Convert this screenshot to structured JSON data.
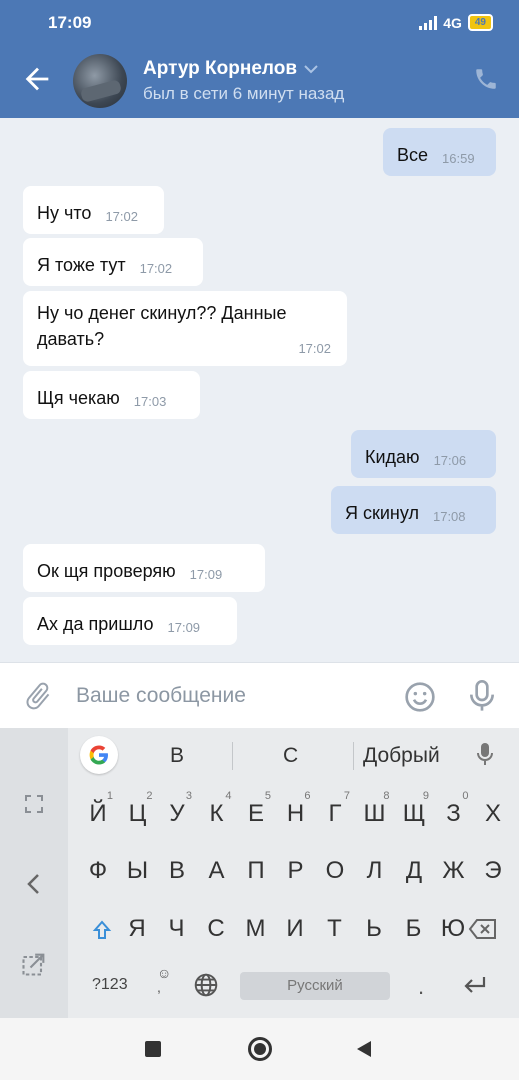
{
  "status": {
    "time": "17:09",
    "network": "4G",
    "battery": "49"
  },
  "header": {
    "name": "Артур Корнелов",
    "status": "был в сети 6 минут назад"
  },
  "messages": [
    {
      "text": "Все",
      "time": "16:59",
      "out": true
    },
    {
      "text": "Ну что",
      "time": "17:02",
      "out": false
    },
    {
      "text": "Я тоже тут",
      "time": "17:02",
      "out": false
    },
    {
      "text": "Ну чо денег скинул?? Данные давать?",
      "time": "17:02",
      "out": false
    },
    {
      "text": "Щя чекаю",
      "time": "17:03",
      "out": false
    },
    {
      "text": "Кидаю",
      "time": "17:06",
      "out": true
    },
    {
      "text": "Я скинул",
      "time": "17:08",
      "out": true
    },
    {
      "text": "Ок щя проверяю",
      "time": "17:09",
      "out": false
    },
    {
      "text": "Ах да пришло",
      "time": "17:09",
      "out": false
    }
  ],
  "composer": {
    "placeholder": "Ваше сообщение"
  },
  "keyboard": {
    "suggestions": [
      "В",
      "С",
      "Добрый"
    ],
    "row1": [
      "Й",
      "Ц",
      "У",
      "К",
      "Е",
      "Н",
      "Г",
      "Ш",
      "Щ",
      "З",
      "Х"
    ],
    "row1_hints": [
      "1",
      "2",
      "3",
      "4",
      "5",
      "6",
      "7",
      "8",
      "9",
      "0"
    ],
    "row2": [
      "Ф",
      "Ы",
      "В",
      "А",
      "П",
      "Р",
      "О",
      "Л",
      "Д",
      "Ж",
      "Э"
    ],
    "row3": [
      "Я",
      "Ч",
      "С",
      "М",
      "И",
      "Т",
      "Ь",
      "Б",
      "Ю"
    ],
    "symbols": "?123",
    "space": "Русский",
    "period": "."
  }
}
